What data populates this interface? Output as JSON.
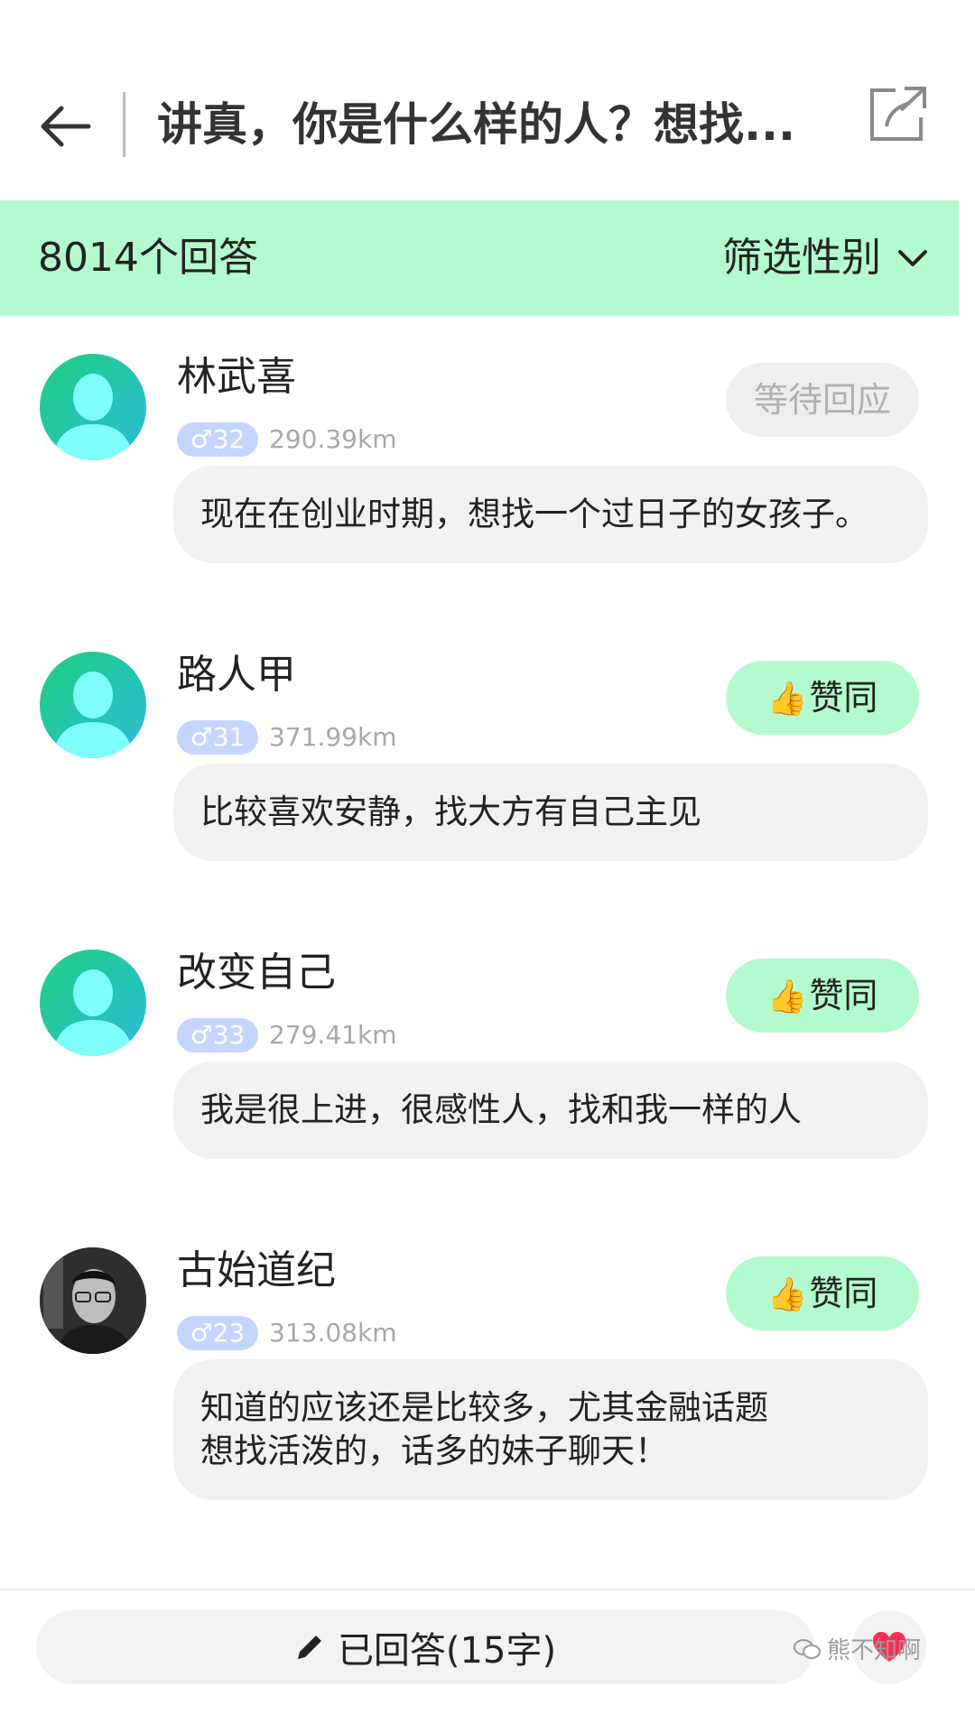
{
  "header": {
    "title": "讲真，你是什么样的人？想找..."
  },
  "filterbar": {
    "count": "8014个回答",
    "filter_label": "筛选性别"
  },
  "answers": [
    {
      "name": "林武喜",
      "age": "♂32",
      "distance": "290.39km",
      "button": "等待回应",
      "button_state": "waiting",
      "text": "现在在创业时期，想找一个过日子的女孩子。"
    },
    {
      "name": "路人甲",
      "age": "♂31",
      "distance": "371.99km",
      "button": "赞同",
      "button_state": "agree",
      "text": "比较喜欢安静，找大方有自己主见"
    },
    {
      "name": "改变自己",
      "age": "♂33",
      "distance": "279.41km",
      "button": "赞同",
      "button_state": "agree",
      "text": "我是很上进，很感性人，找和我一样的人"
    },
    {
      "name": "古始道纪",
      "age": "♂23",
      "distance": "313.08km",
      "button": "赞同",
      "button_state": "agree",
      "text_line1": "知道的应该还是比较多，尤其金融话题",
      "text_line2": "想找活泼的，话多的妹子聊天！"
    }
  ],
  "bottom": {
    "replied_label": "已回答(15字)",
    "watermark": "熊不知啊"
  },
  "colors": {
    "accent_green": "#b3fbce",
    "gender_badge": "#c4d6ff",
    "heart": "#ff2d55"
  }
}
